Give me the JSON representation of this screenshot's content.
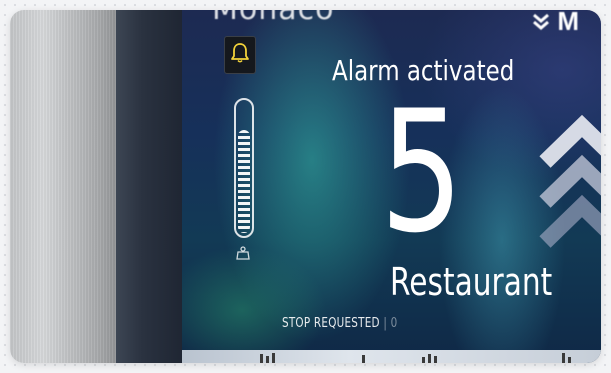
{
  "screen": {
    "top_text": "Monaco",
    "logo_text": "M",
    "status_title": "Alarm activated",
    "floor_number": "5",
    "destination": "Restaurant",
    "footer": {
      "stop_label": "STOP REQUESTED",
      "separator": "|",
      "trailing": "0"
    }
  },
  "icons": {
    "alarm": "bell-icon",
    "load": "load-indicator",
    "weight": "weight-icon",
    "direction": "up-arrows-icon",
    "logo": "brand-logo-icon"
  },
  "load_level_percent": 80,
  "colors": {
    "alarm_bell": "#f2d23a",
    "text": "#ffffff",
    "aurora_green": "#36beaa",
    "screen_bg": "#16305a"
  }
}
